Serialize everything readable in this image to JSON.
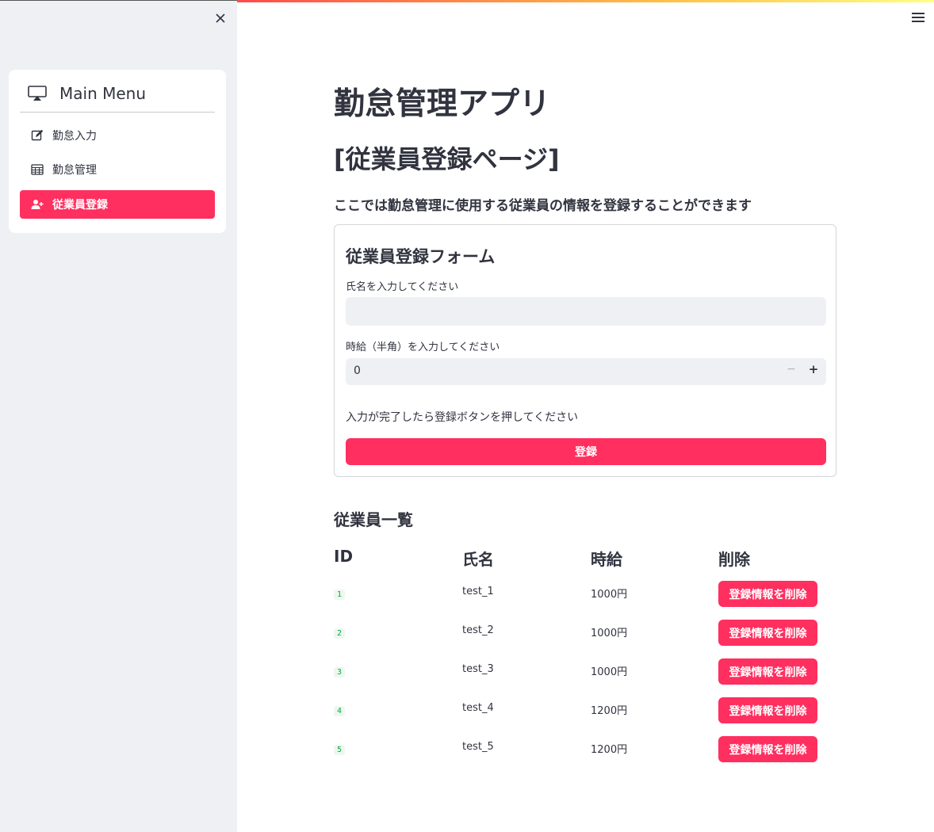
{
  "sidebar": {
    "title": "Main Menu",
    "items": [
      {
        "label": "勤怠入力",
        "icon": "pencil-square-icon"
      },
      {
        "label": "勤怠管理",
        "icon": "table-icon"
      },
      {
        "label": "従業員登録",
        "icon": "person-plus-icon",
        "active": true
      }
    ]
  },
  "page": {
    "title": "勤怠管理アプリ",
    "subtitle": "[従業員登録ページ]",
    "description": "ここでは勤怠管理に使用する従業員の情報を登録することができます"
  },
  "form": {
    "title": "従業員登録フォーム",
    "name_label": "氏名を入力してください",
    "name_value": "",
    "wage_label": "時給（半角）を入力してください",
    "wage_value": "0",
    "minus_glyph": "−",
    "plus_glyph": "+",
    "note": "入力が完了したら登録ボタンを押してください",
    "submit_label": "登録"
  },
  "employees": {
    "title": "従業員一覧",
    "headers": [
      "ID",
      "氏名",
      "時給",
      "削除"
    ],
    "rows": [
      {
        "id": "1",
        "name": "test_1",
        "wage": "1000円",
        "delete_label": "登録情報を削除"
      },
      {
        "id": "2",
        "name": "test_2",
        "wage": "1000円",
        "delete_label": "登録情報を削除"
      },
      {
        "id": "3",
        "name": "test_3",
        "wage": "1000円",
        "delete_label": "登録情報を削除"
      },
      {
        "id": "4",
        "name": "test_4",
        "wage": "1200円",
        "delete_label": "登録情報を削除"
      },
      {
        "id": "5",
        "name": "test_5",
        "wage": "1200円",
        "delete_label": "登録情報を削除"
      }
    ]
  },
  "colors": {
    "accent": "#ff2f5f",
    "sidebar_bg": "#eef0f4",
    "id_green": "#09ab3b"
  }
}
